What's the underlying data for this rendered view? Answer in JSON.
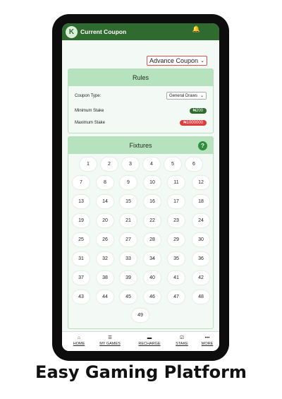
{
  "app": {
    "title": "Current Coupon",
    "logo_glyph": "K"
  },
  "header": {
    "coupon_mode": "Advance Coupon"
  },
  "rules": {
    "heading": "Rules",
    "coupon_type_label": "Coupon Type:",
    "coupon_type_value": "General Draws",
    "min_stake_label": "Minimum Stake",
    "min_stake_value": "₦200",
    "max_stake_label": "Maximum Stake",
    "max_stake_value": "₦1000000",
    "min_color": "#2f6b2f",
    "max_color": "#e03c3c"
  },
  "fixtures": {
    "heading": "Fixtures",
    "help_glyph": "?",
    "numbers": [
      "1",
      "2",
      "3",
      "4",
      "5",
      "6",
      "7",
      "8",
      "9",
      "10",
      "11",
      "12",
      "13",
      "14",
      "15",
      "16",
      "17",
      "18",
      "19",
      "20",
      "21",
      "22",
      "23",
      "24",
      "25",
      "26",
      "27",
      "28",
      "29",
      "30",
      "31",
      "32",
      "33",
      "34",
      "35",
      "36",
      "37",
      "38",
      "39",
      "40",
      "41",
      "42",
      "43",
      "44",
      "45",
      "46",
      "47",
      "48",
      "49"
    ]
  },
  "nav": [
    {
      "label": "HOME",
      "icon": "home-icon"
    },
    {
      "label": "MY GAMES",
      "icon": "list-icon"
    },
    {
      "label": "RECHARGE",
      "icon": "card-icon"
    },
    {
      "label": "STAKE",
      "icon": "checkbox-icon"
    },
    {
      "label": "MORE",
      "icon": "more-icon"
    }
  ],
  "tagline": "Easy Gaming Platform"
}
